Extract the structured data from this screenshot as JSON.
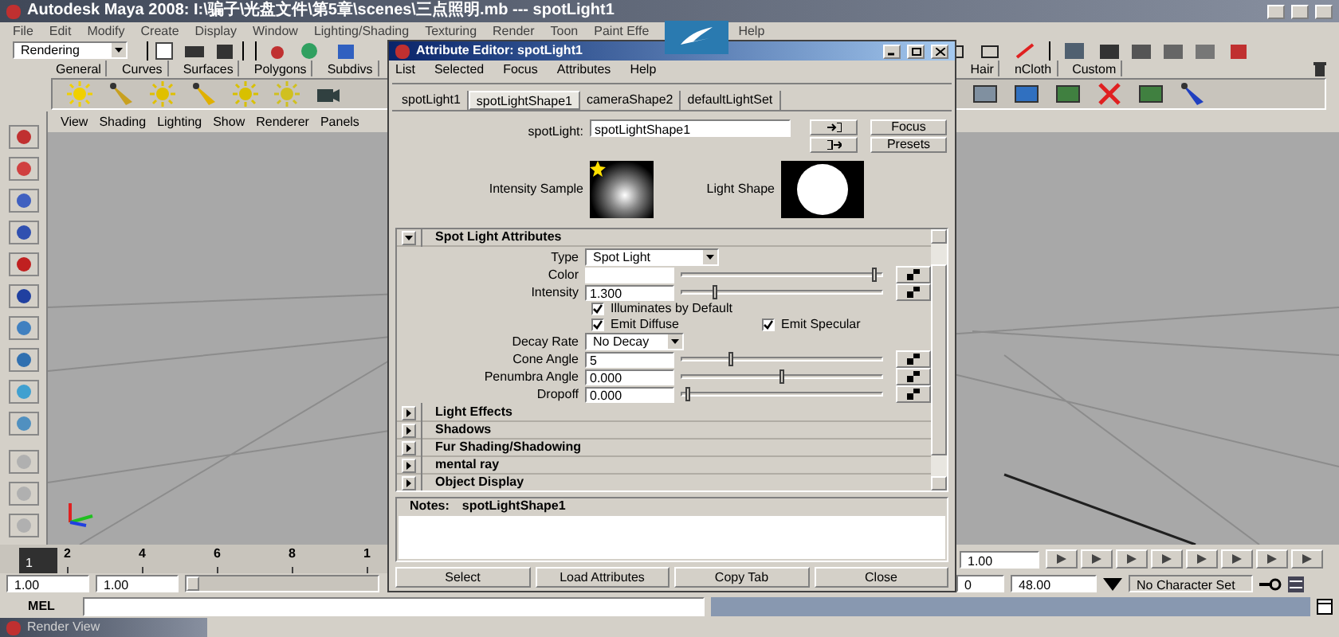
{
  "window": {
    "title": "Autodesk Maya 2008: I:\\骗子\\光盘文件\\第5章\\scenes\\三点照明.mb  ---  spotLight1"
  },
  "menu": [
    "File",
    "Edit",
    "Modify",
    "Create",
    "Display",
    "Window",
    "Lighting/Shading",
    "Texturing",
    "Render",
    "Toon",
    "Paint Effe",
    "Help"
  ],
  "status_line": {
    "mode": "Rendering"
  },
  "shelf_tabs": [
    {
      "label": "General",
      "selected": false
    },
    {
      "label": "Curves",
      "selected": false
    },
    {
      "label": "Surfaces",
      "selected": false
    },
    {
      "label": "Polygons",
      "selected": false
    },
    {
      "label": "Subdivs",
      "selected": false
    },
    {
      "label": "Hair",
      "selected": false
    },
    {
      "label": "nCloth",
      "selected": false
    },
    {
      "label": "Custom",
      "selected": false
    }
  ],
  "panel_menu": [
    "View",
    "Shading",
    "Lighting",
    "Show",
    "Renderer",
    "Panels"
  ],
  "attribute_editor": {
    "title": "Attribute Editor: spotLight1",
    "menu": [
      "List",
      "Selected",
      "Focus",
      "Attributes",
      "Help"
    ],
    "tabs": [
      {
        "label": "spotLight1",
        "selected": false
      },
      {
        "label": "spotLightShape1",
        "selected": true
      },
      {
        "label": "cameraShape2",
        "selected": false
      },
      {
        "label": "defaultLightSet",
        "selected": false
      }
    ],
    "node_label": "spotLight:",
    "node_value": "spotLightShape1",
    "buttons": [
      "Focus",
      "Presets"
    ],
    "intensity_sample_label": "Intensity Sample",
    "light_shape_label": "Light Shape",
    "section_title": "Spot Light Attributes",
    "section_expanded": true,
    "attributes": [
      {
        "kind": "dropdown",
        "label": "Type",
        "value": "Spot Light"
      },
      {
        "kind": "color",
        "label": "Color",
        "level": 0.97
      },
      {
        "kind": "slider",
        "label": "Intensity",
        "value": "1.300",
        "level": 0.17
      },
      {
        "kind": "checkboxes",
        "items": [
          {
            "label": "Illuminates by Default",
            "checked": true
          }
        ]
      },
      {
        "kind": "checkboxes",
        "items": [
          {
            "label": "Emit Diffuse",
            "checked": true
          },
          {
            "label": "Emit Specular",
            "checked": true
          }
        ]
      },
      {
        "kind": "dropdown",
        "label": "Decay Rate",
        "value": "No Decay"
      },
      {
        "kind": "slider",
        "label": "Cone Angle",
        "value": "5",
        "level": 0.25
      },
      {
        "kind": "slider",
        "label": "Penumbra Angle",
        "value": "0.000",
        "level": 0.5
      },
      {
        "kind": "slider",
        "label": "Dropoff",
        "value": "0.000",
        "level": 0.03
      }
    ],
    "collapsed_sections": [
      {
        "title": "Light Effects",
        "expanded": false
      },
      {
        "title": "Shadows",
        "expanded": false
      },
      {
        "title": "Fur Shading/Shadowing",
        "expanded": false
      },
      {
        "title": "mental ray",
        "expanded": false
      },
      {
        "title": "Object Display",
        "expanded": false
      }
    ],
    "notes_label": "Notes:",
    "notes_node": "spotLightShape1",
    "bottom_buttons": [
      "Select",
      "Load Attributes",
      "Copy Tab",
      "Close"
    ]
  },
  "time_slider": {
    "ticks": [
      "2",
      "4",
      "6",
      "8",
      "1"
    ],
    "current_frame": "1",
    "level": 0,
    "right_field": "1.00"
  },
  "range_slider": {
    "start": "1.00",
    "inner_start": "1.00",
    "level": 0,
    "inner_end": "0",
    "end": "48.00",
    "character_set": "No Character Set"
  },
  "command_line": {
    "label": "MEL"
  },
  "taskbar": {
    "item": "Render View"
  }
}
